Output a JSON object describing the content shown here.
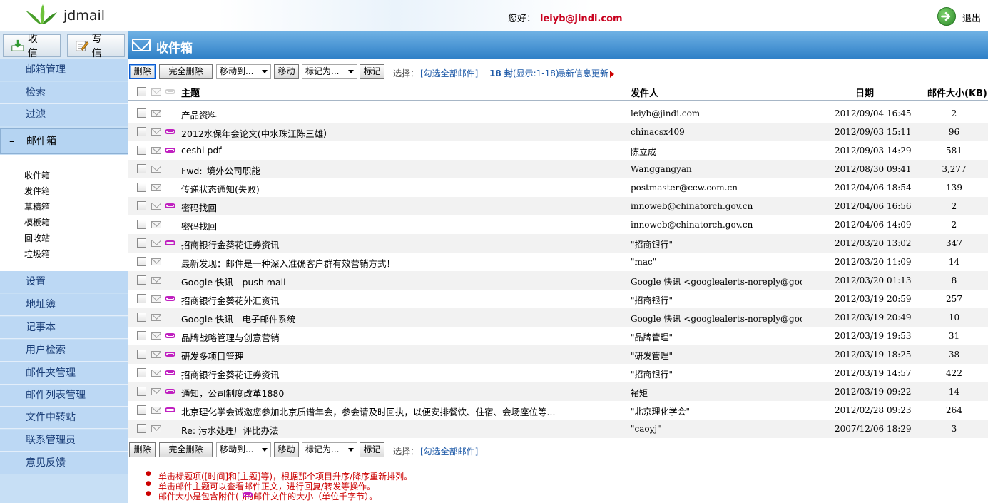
{
  "app": {
    "logo_text": "jdmail",
    "greeting": "您好：",
    "user_email": "leiyb@jindi.com",
    "logout": "退出"
  },
  "top_buttons": {
    "receive": "收 信",
    "compose": "写 信"
  },
  "title": "收件箱",
  "sidebar": {
    "items_top": [
      "邮箱管理",
      "检索",
      "过滤"
    ],
    "mailbox": {
      "sign": "–",
      "label": "邮件箱"
    },
    "folders": [
      "收件箱",
      "发件箱",
      "草稿箱",
      "模板箱",
      "回收站",
      "垃圾箱"
    ],
    "items_bottom": [
      "设置",
      "地址簿",
      "记事本",
      "用户检索",
      "邮件夹管理",
      "邮件列表管理",
      "文件中转站",
      "联系管理员",
      "意见反馈"
    ]
  },
  "toolbar": {
    "delete": "删除",
    "delete_all": "完全删除",
    "move_select": "移动到...",
    "move": "移动",
    "mark_select": "标记为...",
    "mark": "标记",
    "select_label": "选择：",
    "select_all": "[勾选全部邮件]",
    "count_bold": "18 封",
    "count_rest": "(显示:1-18)",
    "latest": "最新信息更新"
  },
  "columns": {
    "subject": "主题",
    "sender": "发件人",
    "date": "日期",
    "size": "邮件大小(KB)"
  },
  "mails": [
    {
      "subject": "产品资料",
      "from": "leiyb@jindi.com",
      "date": "2012/09/04 16:45",
      "size": "2",
      "attach": false
    },
    {
      "subject": "2012水保年会论文(中水珠江陈三雄）",
      "from": "chinacsx409",
      "date": "2012/09/03 15:11",
      "size": "96",
      "attach": true
    },
    {
      "subject": "ceshi pdf",
      "from": "陈立成",
      "date": "2012/09/03 14:29",
      "size": "581",
      "attach": true
    },
    {
      "subject": "Fwd:_境外公司职能",
      "from": "Wanggangyan",
      "date": "2012/08/30 09:41",
      "size": "3,277",
      "attach": false
    },
    {
      "subject": "传递状态通知(失败)",
      "from": "postmaster@ccw.com.cn",
      "date": "2012/04/06 18:54",
      "size": "139",
      "attach": false
    },
    {
      "subject": "密码找回",
      "from": "innoweb@chinatorch.gov.cn",
      "date": "2012/04/06 16:56",
      "size": "2",
      "attach": true
    },
    {
      "subject": "密码找回",
      "from": "innoweb@chinatorch.gov.cn",
      "date": "2012/04/06 14:09",
      "size": "2",
      "attach": false
    },
    {
      "subject": "招商银行金葵花证券资讯",
      "from": "\"招商银行\"",
      "date": "2012/03/20 13:02",
      "size": "347",
      "attach": true
    },
    {
      "subject": "最新发现：邮件是一种深入准确客户群有效营销方式！",
      "from": "\"mac\"",
      "date": "2012/03/20 11:09",
      "size": "14",
      "attach": false
    },
    {
      "subject": "Google 快讯 - push mail",
      "from": "Google 快讯 <googlealerts-noreply@google...",
      "date": "2012/03/20 01:13",
      "size": "8",
      "attach": false
    },
    {
      "subject": "招商银行金葵花外汇资讯",
      "from": "\"招商银行\"",
      "date": "2012/03/19 20:59",
      "size": "257",
      "attach": true
    },
    {
      "subject": "Google 快讯 - 电子邮件系统",
      "from": "Google 快讯 <googlealerts-noreply@google...",
      "date": "2012/03/19 20:49",
      "size": "10",
      "attach": false
    },
    {
      "subject": "品牌战略管理与创意营销",
      "from": "\"品牌管理\"",
      "date": "2012/03/19 19:53",
      "size": "31",
      "attach": true
    },
    {
      "subject": "研发多项目管理",
      "from": "\"研发管理\"",
      "date": "2012/03/19 18:25",
      "size": "38",
      "attach": true
    },
    {
      "subject": "招商银行金葵花证券资讯",
      "from": "\"招商银行\"",
      "date": "2012/03/19 14:57",
      "size": "422",
      "attach": true
    },
    {
      "subject": "通知，公司制度改革1880",
      "from": "褚矩",
      "date": "2012/03/19 09:22",
      "size": "14",
      "attach": true
    },
    {
      "subject": "北京理化学会诚邀您参加北京质谱年会，参会请及时回执，以便安排餐饮、住宿、会场座位等...",
      "from": "\"北京理化学会\"",
      "date": "2012/02/28 09:23",
      "size": "264",
      "attach": true
    },
    {
      "subject": "Re: 污水处理厂评比办法",
      "from": "\"caoyj\"",
      "date": "2007/12/06 18:29",
      "size": "3",
      "attach": false
    }
  ],
  "notes": [
    "单击标题项([时间]和[主题]等)，根据那个项目升序/降序重新排列。",
    "单击邮件主题可以查看邮件正文，进行回复/转发等操作。",
    "邮件大小是包含附件(    )的邮件文件的大小（单位千字节）。"
  ],
  "colors": {
    "title_bar": "#2f80c7",
    "sidebar": "#bcd8f4",
    "accent_red": "#c8001e",
    "link": "#1e5aa8"
  }
}
